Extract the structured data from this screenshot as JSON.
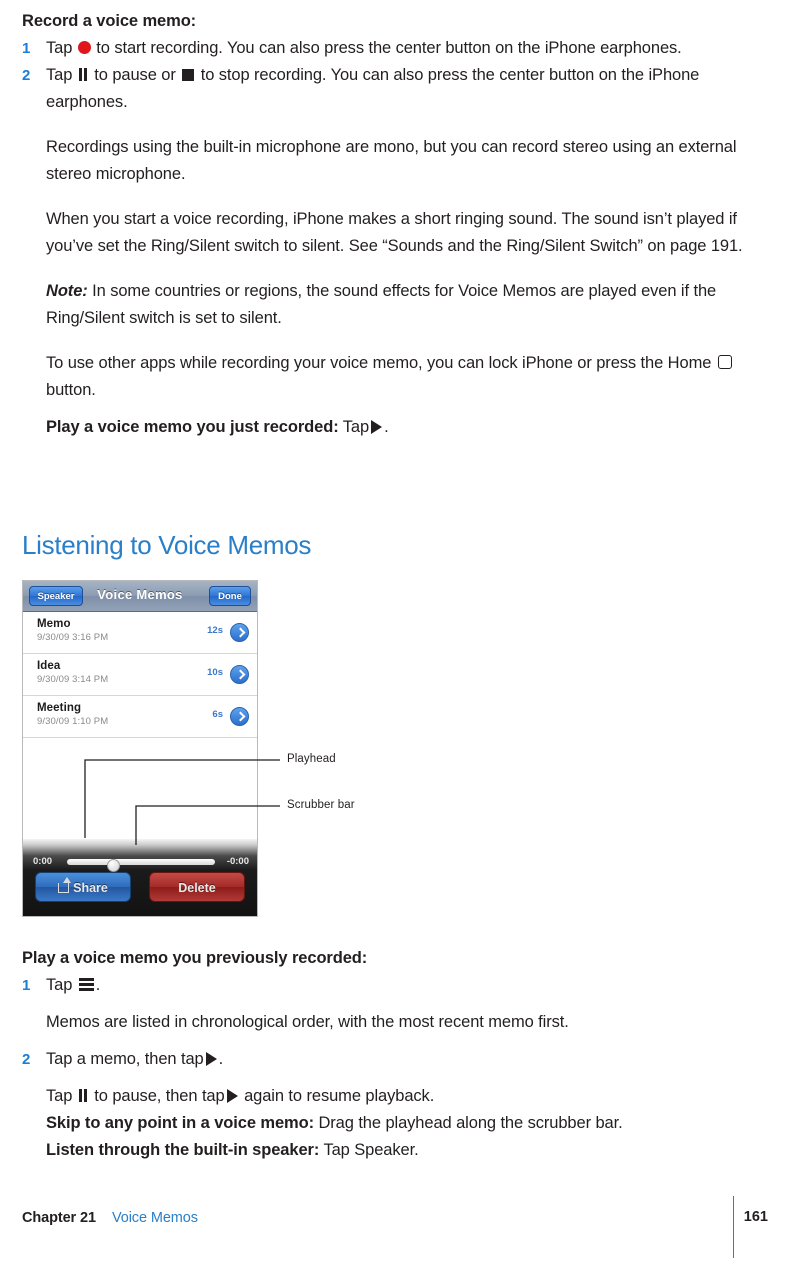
{
  "doc": {
    "record_heading": "Record a voice memo:",
    "step1_num": "1",
    "step1_a": "Tap",
    "step1_b": "to start recording. You can also press the center button on the iPhone earphones.",
    "step2_num": "2",
    "step2_a": "Tap",
    "step2_b": "to pause or",
    "step2_c": "to stop recording. You can also press the center button on the iPhone earphones.",
    "para_mono": "Recordings using the built-in microphone are mono, but you can record stereo using an external stereo microphone.",
    "para_ring": "When you start a voice recording, iPhone makes a short ringing sound. The sound isn’t played if you’ve set the Ring/Silent switch to silent. See “Sounds and the Ring/Silent Switch” on page 191.",
    "note_label": "Note:",
    "note_text": "In some countries or regions, the sound effects for Voice Memos are played even if the Ring/Silent switch is set to silent.",
    "para_other_apps_a": "To use other apps while recording your voice memo, you can lock iPhone or press the Home",
    "para_other_apps_b": "button.",
    "play_just_label": "Play a voice memo you just recorded:",
    "play_just_tap": "Tap",
    "play_just_period": ".",
    "section_title": "Listening to Voice Memos",
    "play_prev_label": "Play a voice memo you previously recorded:",
    "prev_step1_num": "1",
    "prev_step1_a": "Tap",
    "prev_step1_period": ".",
    "prev_note": "Memos are listed in chronological order, with the most recent memo first.",
    "prev_step2_num": "2",
    "prev_step2_a": "Tap a memo, then tap",
    "prev_step2_period": ".",
    "resume_a": "Tap",
    "resume_b": "to pause, then tap",
    "resume_c": "again to resume playback.",
    "skip_label": "Skip to any point in a voice memo:",
    "skip_text": "Drag the playhead along the scrubber bar.",
    "speaker_label": "Listen through the built-in speaker:",
    "speaker_text": "Tap Speaker."
  },
  "figure": {
    "nav": {
      "left_button": "Speaker",
      "title": "Voice Memos",
      "right_button": "Done"
    },
    "memos": [
      {
        "name": "Memo",
        "date": "9/30/09 3:16 PM",
        "duration": "12s"
      },
      {
        "name": "Idea",
        "date": "9/30/09 3:14 PM",
        "duration": "10s"
      },
      {
        "name": "Meeting",
        "date": "9/30/09 1:10 PM",
        "duration": "6s"
      }
    ],
    "player": {
      "elapsed": "0:00",
      "remaining": "-0:00",
      "share_button": "Share",
      "delete_button": "Delete"
    },
    "callouts": {
      "playhead": "Playhead",
      "scrubber": "Scrubber bar"
    }
  },
  "footer": {
    "chapter": "Chapter 21",
    "chapter_name": "Voice Memos",
    "page_number": "161"
  },
  "colors": {
    "accent_blue": "#2a7fc9",
    "record_red": "#e1161c",
    "text": "#231f20"
  }
}
